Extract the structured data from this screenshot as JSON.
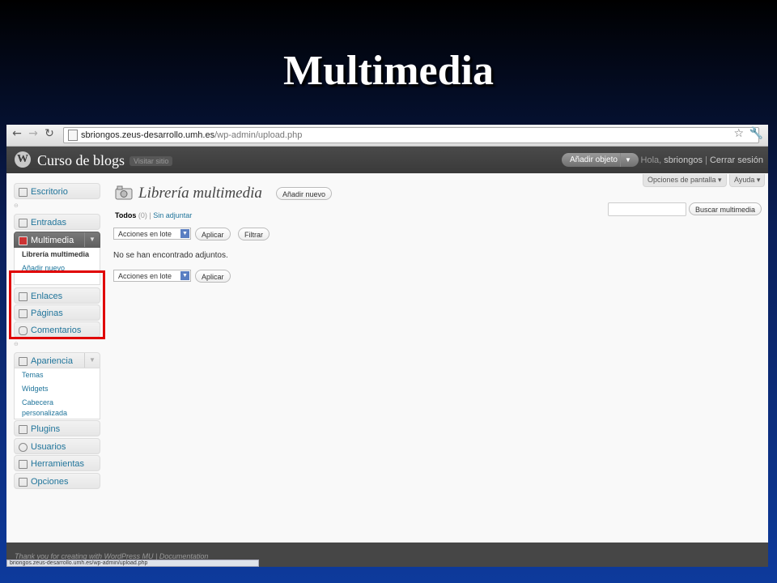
{
  "slide": {
    "title": "Multimedia"
  },
  "browser": {
    "back_icon": "←",
    "forward_icon": "→",
    "reload_icon": "↻",
    "url_host": "sbriongos.zeus-desarrollo.umh.es",
    "url_path": "/wp-admin/upload.php",
    "star_icon": "☆",
    "wrench_icon": "🔧",
    "status_text": "briongos.zeus-desarrollo.umh.es/wp-admin/upload.php"
  },
  "wp_header": {
    "logo": "W",
    "site_name": "Curso de blogs",
    "visit_site": "Visitar sitio",
    "add_object": "Añadir objeto",
    "greeting": "Hola, ",
    "username": "sbriongos",
    "separator": " | ",
    "logout": "Cerrar sesión"
  },
  "screen_options": {
    "options": "Opciones de pantalla ▾",
    "help": "Ayuda ▾"
  },
  "menu": {
    "dashboard": "Escritorio",
    "posts": "Entradas",
    "media": "Multimedia",
    "media_sub": [
      "Librería multimedia",
      "Añadir nuevo"
    ],
    "links": "Enlaces",
    "pages": "Páginas",
    "comments": "Comentarios",
    "appearance": "Apariencia",
    "appearance_sub": [
      "Temas",
      "Widgets",
      "Cabecera personalizada"
    ],
    "plugins": "Plugins",
    "users": "Usuarios",
    "tools": "Herramientas",
    "settings": "Opciones"
  },
  "page": {
    "title": "Librería multimedia",
    "add_new": "Añadir nuevo",
    "filter_all": "Todos",
    "filter_all_count": "(0)",
    "filter_sep": "|",
    "filter_unattached": "Sin adjuntar",
    "search_button": "Buscar multimedia",
    "bulk_actions": "Acciones en lote",
    "apply": "Aplicar",
    "filter": "Filtrar",
    "empty_message": "No se han encontrado adjuntos."
  },
  "footer": {
    "text": "Thank you for creating with WordPress MU | Documentation"
  }
}
